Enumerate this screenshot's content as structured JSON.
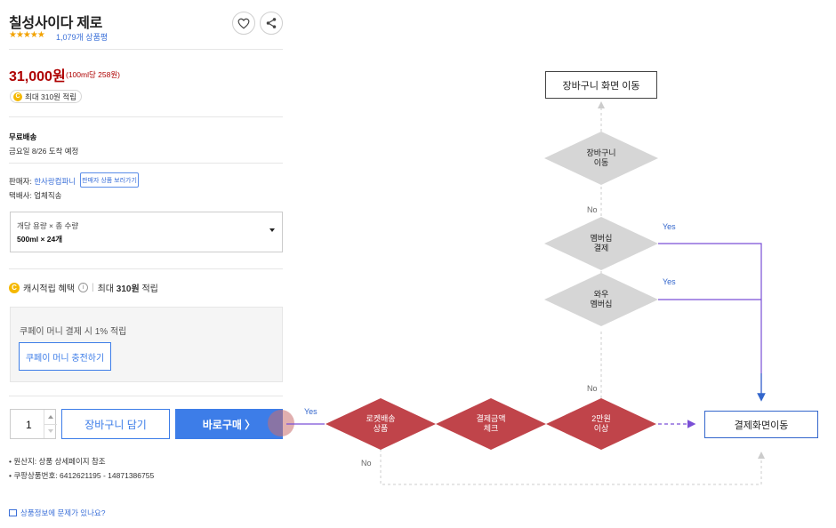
{
  "product": {
    "title": "칠성사이다 제로",
    "stars": "★★★★★",
    "rating_count": "1,079개 상품평",
    "price": "31,000원",
    "unit_price": "(100ml당 258원)",
    "reward_coin": "C",
    "reward_pill": "최대 310원 적립",
    "shipping_title": "무료배송",
    "shipping_date": "금요일 8/26 도착 예정",
    "seller_label": "판매자: ",
    "seller_name": "한사랑컵파니",
    "seller_button": "판매자 상품 보러가기",
    "courier": "택배사: 업체직송",
    "option_label": "개당 용량 × 총 수량",
    "option_value": "500ml × 24개",
    "cash_label": "캐시적립 혜택",
    "cash_sep": "|",
    "cash_max": "최대 ",
    "cash_amount": "310원",
    "cash_suffix": " 적립",
    "coupon_text": "쿠페이 머니 결제 시 1% 적립",
    "coupon_button": "쿠페이 머니 충전하기",
    "quantity": "1",
    "cart_button": "장바구니 담기",
    "buy_button": "바로구매 〉",
    "origin": "원산지: 상품 상세페이지 참조",
    "product_code": "쿠팡상품번호: 6412621195 - 14871386755",
    "report": "상품정보에 문제가 있나요?"
  },
  "flow": {
    "cart_move": "장바구니 화면 이동",
    "checkout_move": "결제화면이동",
    "d_cart": [
      "장바구니",
      "이동"
    ],
    "d_membership": [
      "멤버십",
      "결제"
    ],
    "d_wow": [
      "와우",
      "멤버십"
    ],
    "d_rocket": [
      "로켓배송",
      "상품"
    ],
    "d_amount": [
      "결제금액",
      "체크"
    ],
    "d_20k": [
      "2만원",
      "이상"
    ],
    "yes": "Yes",
    "no": "No"
  },
  "colors": {
    "accent_blue": "#3d7de8",
    "price_red": "#ae0000",
    "diamond_red": "#c0444a",
    "diamond_gray": "#d6d6d6",
    "flow_purple": "#7a4fd6"
  }
}
